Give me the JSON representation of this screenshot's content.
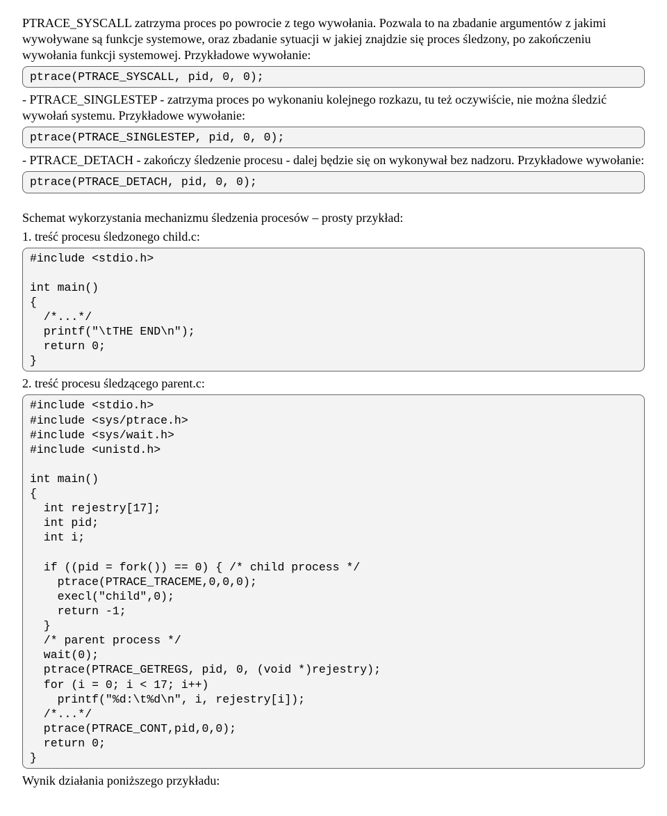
{
  "para1": "PTRACE_SYSCALL zatrzyma proces po powrocie z tego wywołania. Pozwala to na zbadanie argumentów z jakimi wywoływane są funkcje systemowe, oraz zbadanie sytuacji w jakiej znajdzie się proces śledzony, po zakończeniu wywołania funkcji systemowej. Przykładowe wywołanie:",
  "code1": "ptrace(PTRACE_SYSCALL, pid, 0, 0);",
  "para2": " - PTRACE_SINGLESTEP - zatrzyma proces po wykonaniu kolejnego rozkazu, tu też oczywiście, nie można śledzić wywołań systemu. Przykładowe wywołanie:",
  "code2": "ptrace(PTRACE_SINGLESTEP, pid, 0, 0);",
  "para3": " - PTRACE_DETACH - zakończy śledzenie procesu - dalej będzie się on wykonywał bez nadzoru. Przykładowe wywołanie:",
  "code3": "ptrace(PTRACE_DETACH, pid, 0, 0);",
  "para4": "Schemat wykorzystania mechanizmu śledzenia procesów – prosty przykład:",
  "para5": "1. treść procesu śledzonego child.c:",
  "code4": "#include <stdio.h>\n\nint main()\n{\n  /*...*/\n  printf(\"\\tTHE END\\n\");\n  return 0;\n}",
  "para6": "2. treść procesu śledzącego parent.c:",
  "code5": "#include <stdio.h>\n#include <sys/ptrace.h>\n#include <sys/wait.h>\n#include <unistd.h>\n\nint main()\n{\n  int rejestry[17];\n  int pid;\n  int i;\n\n  if ((pid = fork()) == 0) { /* child process */\n    ptrace(PTRACE_TRACEME,0,0,0);\n    execl(\"child\",0);\n    return -1;\n  }\n  /* parent process */\n  wait(0);\n  ptrace(PTRACE_GETREGS, pid, 0, (void *)rejestry);\n  for (i = 0; i < 17; i++)\n    printf(\"%d:\\t%d\\n\", i, rejestry[i]);\n  /*...*/\n  ptrace(PTRACE_CONT,pid,0,0);\n  return 0;\n}",
  "para7": "Wynik działania poniższego przykładu:"
}
